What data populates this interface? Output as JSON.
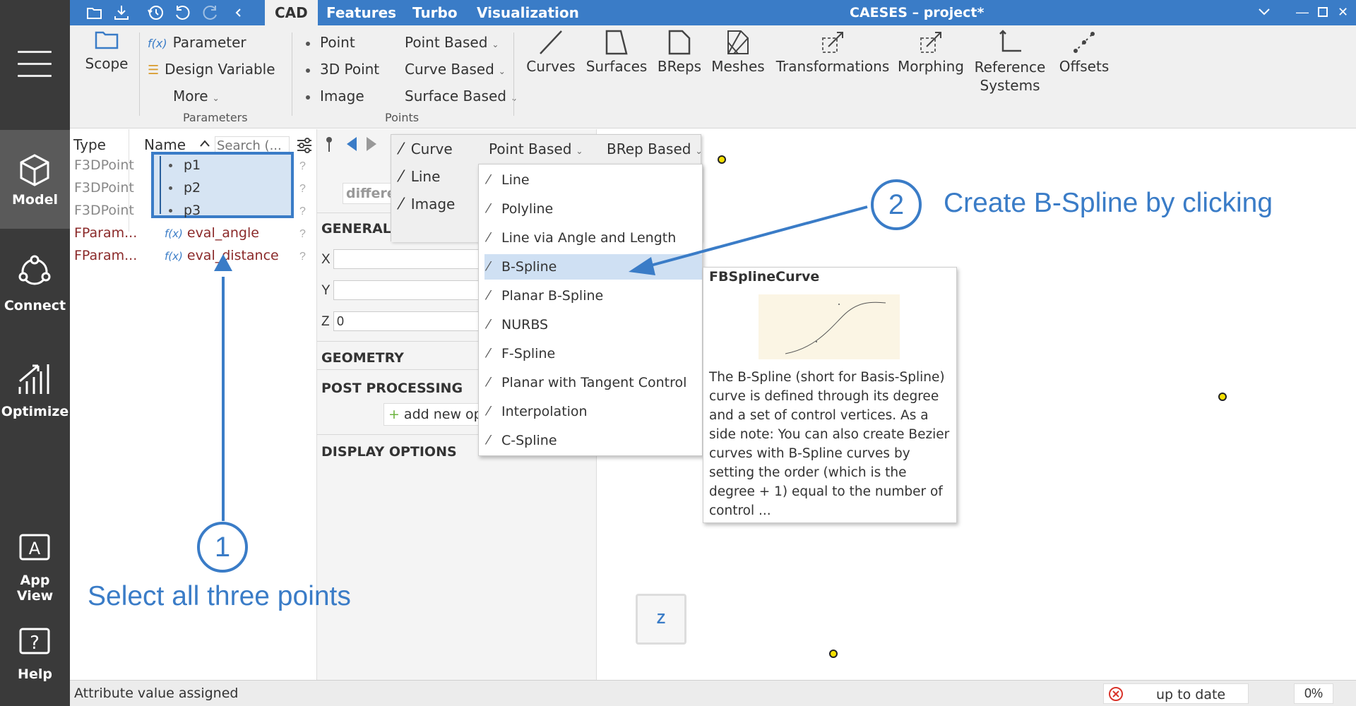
{
  "app": {
    "title": "CAESES – project*"
  },
  "tabs": [
    "CAD",
    "Features",
    "Turbo",
    "Visualization"
  ],
  "sidebar": {
    "items": [
      {
        "label": "Model"
      },
      {
        "label": "Connect"
      },
      {
        "label": "Optimize"
      },
      {
        "label": "App View"
      },
      {
        "label": "Help"
      }
    ]
  },
  "ribbon": {
    "scope": "Scope",
    "parameter": "Parameter",
    "design_variable": "Design Variable",
    "more": "More",
    "group_parameters": "Parameters",
    "point": "Point",
    "point_3d": "3D Point",
    "image": "Image",
    "point_based": "Point Based",
    "curve_based": "Curve Based",
    "surface_based": "Surface Based",
    "group_points": "Points",
    "curves": "Curves",
    "surfaces": "Surfaces",
    "breps": "BReps",
    "meshes": "Meshes",
    "transformations": "Transformations",
    "morphing": "Morphing",
    "reference_systems_1": "Reference",
    "reference_systems_2": "Systems",
    "offsets": "Offsets"
  },
  "tree": {
    "col_type": "Type",
    "col_name": "Name",
    "search_placeholder": "Search (...",
    "rows": [
      {
        "type": "F3DPoint",
        "name": "p1"
      },
      {
        "type": "F3DPoint",
        "name": "p2"
      },
      {
        "type": "F3DPoint",
        "name": "p3"
      },
      {
        "type": "FParam...",
        "name": "eval_angle"
      },
      {
        "type": "FParam...",
        "name": "eval_distance"
      }
    ]
  },
  "props": {
    "filter_text": "differe",
    "general": "GENERAL",
    "x_label": "X",
    "y_label": "Y",
    "z_label": "Z",
    "z_value": "0",
    "geometry": "GEOMETRY",
    "post_processing": "POST PROCESSING",
    "add_new": "add new op",
    "display_options": "DISPLAY OPTIONS"
  },
  "menu1": {
    "items": [
      "Curve",
      "Line",
      "Image"
    ],
    "point_based": "Point Based",
    "brep_based": "BRep Based"
  },
  "menu2": {
    "items": [
      "Line",
      "Polyline",
      "Line via Angle and Length",
      "B-Spline",
      "Planar B-Spline",
      "NURBS",
      "F-Spline",
      "Planar with Tangent Control",
      "Interpolation",
      "C-Spline"
    ],
    "highlighted": "B-Spline"
  },
  "tooltip": {
    "title": "FBSplineCurve",
    "description": "The B-Spline (short for Basis-Spline) curve is defined through its degree and a set of control vertices. As a side note: You can also create Bezier curves with B-Spline curves by setting the order (which is the degree + 1) equal to the number of control ..."
  },
  "annotations": {
    "step1_num": "1",
    "step1_text": "Select all three points",
    "step2_num": "2",
    "step2_text": "Create B-Spline by clicking"
  },
  "view": {
    "axis_label": "Z"
  },
  "status": {
    "message": "Attribute value assigned",
    "state": "up to date",
    "progress": "0%"
  },
  "colors": {
    "accent": "#3a7cc7",
    "sidebar": "#3a3a3a",
    "point": "#f5e000"
  }
}
